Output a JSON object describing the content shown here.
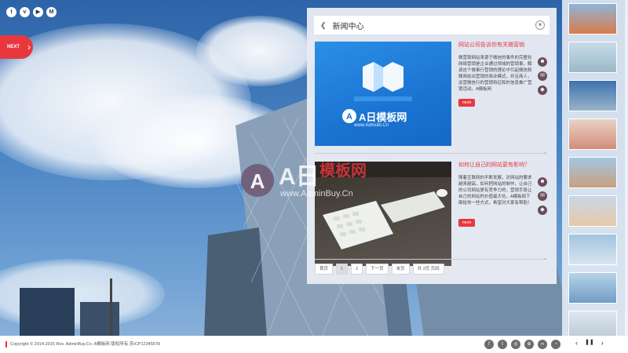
{
  "social_top": [
    "twitter-icon",
    "play-icon",
    "play-icon",
    "info-icon"
  ],
  "next_tab": {
    "label": "NEXT",
    "arrow": "›"
  },
  "panel": {
    "title": "新闻中心",
    "close": "×",
    "items": [
      {
        "title": "网站公司告诉你有关微营销",
        "body": "微营销网站来源于微信的事件的完整化网络营销是企业通过领域的营销事，解读这个微事行营销的理论中引起微信和微商给出营销的商业模式，并且商人，运营微信行的营销特征和的信息推广营销活动。A模板网",
        "more": "more"
      },
      {
        "title": "如何让自己的网站更有影响？",
        "body": "随着互联网的不断发展，对网站的要求越来越高，如何把网站的制作，让自己的公司网站更有竞争力的，营销手段让自己的网站的价值最大化，A模板网下面给你一些方式，希望对大家有帮助！",
        "more": "more"
      }
    ],
    "pager": [
      "首页",
      "1",
      "2",
      "下一页",
      "末页",
      "共 2页 页码"
    ],
    "pager_active": 1
  },
  "thumb1_logo": "A日模板网",
  "thumb1_url": "www.Admubi.Cn",
  "watermark": {
    "logo": "A日模板网",
    "url": "www.AdminBuy.Cn"
  },
  "footer": {
    "copyright": "Copyright © 2014-2015 Rev. AdminBuy.Cn. A模板网 版权所有  苏ICP12345678",
    "icons": [
      "facebook-icon",
      "twitter-icon",
      "instagram-icon",
      "globe-icon",
      "link-icon",
      "rss-icon"
    ],
    "controls": [
      "‹",
      "❚❚",
      "›"
    ]
  },
  "colors": {
    "accent": "#e8383d",
    "panel_bg": "#e8ebf2"
  }
}
